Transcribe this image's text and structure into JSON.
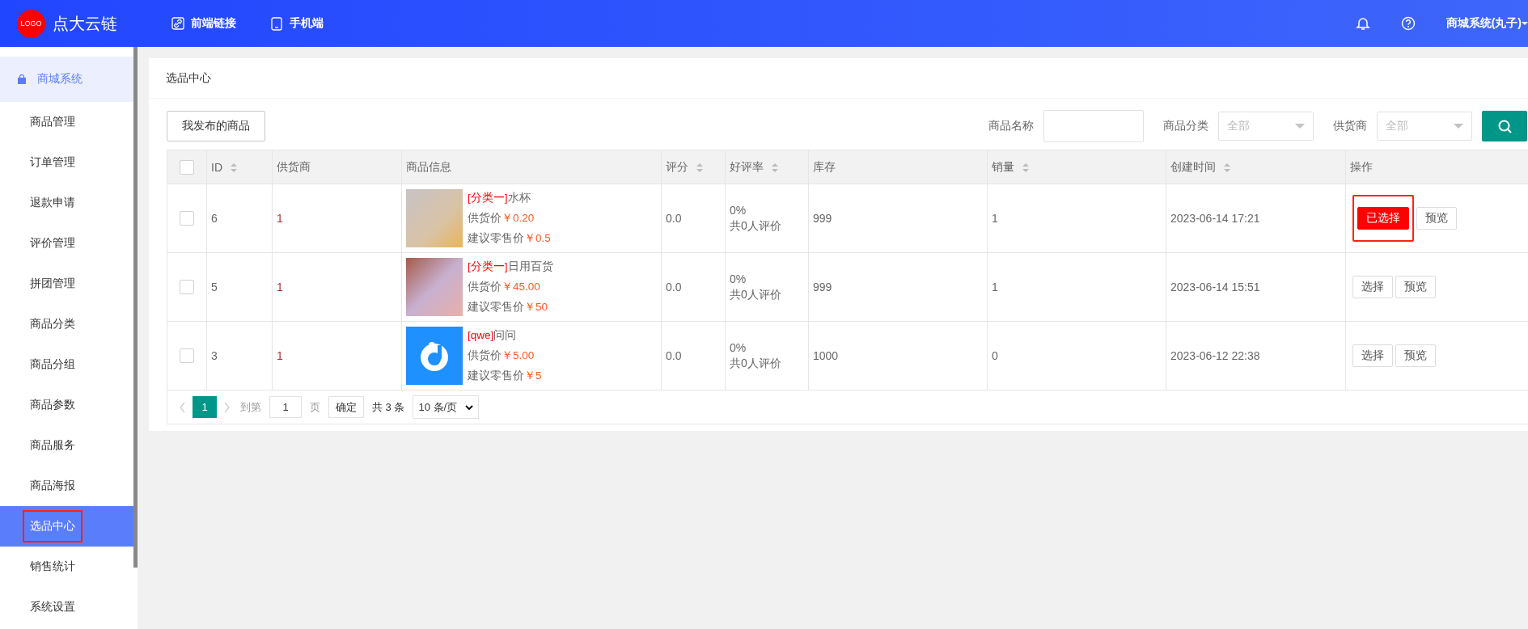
{
  "header": {
    "logo": "LOGO",
    "brand": "点大云链",
    "nav": [
      {
        "label": "前端链接",
        "kind": "link"
      },
      {
        "label": "手机端",
        "kind": "phone"
      }
    ],
    "user": "商城系统(丸子)"
  },
  "sidebar": {
    "group": {
      "label": "商城系统",
      "selected": true
    },
    "items": [
      {
        "label": "商品管理",
        "selected": false,
        "highlighted": false
      },
      {
        "label": "订单管理",
        "selected": false,
        "highlighted": false
      },
      {
        "label": "退款申请",
        "selected": false,
        "highlighted": false
      },
      {
        "label": "评价管理",
        "selected": false,
        "highlighted": false
      },
      {
        "label": "拼团管理",
        "selected": false,
        "highlighted": false
      },
      {
        "label": "商品分类",
        "selected": false,
        "highlighted": false
      },
      {
        "label": "商品分组",
        "selected": false,
        "highlighted": false
      },
      {
        "label": "商品参数",
        "selected": false,
        "highlighted": false
      },
      {
        "label": "商品服务",
        "selected": false,
        "highlighted": false
      },
      {
        "label": "商品海报",
        "selected": false,
        "highlighted": false
      },
      {
        "label": "选品中心",
        "selected": true,
        "highlighted": true
      },
      {
        "label": "销售统计",
        "selected": false,
        "highlighted": false
      },
      {
        "label": "系统设置",
        "selected": false,
        "highlighted": false
      }
    ]
  },
  "panel": {
    "title": "选品中心",
    "my_products_button": "我发布的商品",
    "filters": [
      {
        "label": "商品名称",
        "kind": "input"
      },
      {
        "label": "商品分类",
        "kind": "select",
        "placeholder": "全部"
      },
      {
        "label": "供货商",
        "kind": "select",
        "placeholder": "全部"
      }
    ],
    "table": {
      "select_all": {
        "checked": false
      },
      "columns": [
        {
          "label": "ID",
          "sortable": true
        },
        {
          "label": "供货商",
          "sortable": false
        },
        {
          "label": "商品信息",
          "sortable": false
        },
        {
          "label": "评分",
          "sortable": true
        },
        {
          "label": "好评率",
          "sortable": true
        },
        {
          "label": "库存",
          "sortable": false
        },
        {
          "label": "销量",
          "sortable": true
        },
        {
          "label": "创建时间",
          "sortable": true
        },
        {
          "label": "操作",
          "sortable": false
        }
      ],
      "rows": [
        {
          "checked": false,
          "id": "6",
          "supplier": "1",
          "kind": "photo",
          "category": "[分类一]",
          "name": "水杯",
          "supply_label": "供货价",
          "supply_price": "￥0.20",
          "retail_label": "建议零售价",
          "retail_price": "￥0.5",
          "rating": "0.0",
          "good_rate": "0%",
          "reviews": "共0人评价",
          "stock": "999",
          "sales": "1",
          "created": "2023-06-14 17:21",
          "actions": [
            {
              "label": "已选择",
              "selected": true,
              "highlighted": true
            },
            {
              "label": "预览",
              "selected": false,
              "highlighted": false
            }
          ]
        },
        {
          "checked": false,
          "id": "5",
          "supplier": "1",
          "kind": "photo",
          "category": "[分类一]",
          "name": "日用百货",
          "supply_label": "供货价",
          "supply_price": "￥45.00",
          "retail_label": "建议零售价",
          "retail_price": "￥50",
          "rating": "0.0",
          "good_rate": "0%",
          "reviews": "共0人评价",
          "stock": "999",
          "sales": "1",
          "created": "2023-06-14 15:51",
          "actions": [
            {
              "label": "选择",
              "selected": false,
              "highlighted": false
            },
            {
              "label": "预览",
              "selected": false,
              "highlighted": false
            }
          ]
        },
        {
          "checked": false,
          "id": "3",
          "supplier": "1",
          "kind": "app-logo",
          "category": "[qwe]",
          "name": "问问",
          "supply_label": "供货价",
          "supply_price": "￥5.00",
          "retail_label": "建议零售价",
          "retail_price": "￥5",
          "rating": "0.0",
          "good_rate": "0%",
          "reviews": "共0人评价",
          "stock": "1000",
          "sales": "0",
          "created": "2023-06-12 22:38",
          "actions": [
            {
              "label": "选择",
              "selected": false,
              "highlighted": false
            },
            {
              "label": "预览",
              "selected": false,
              "highlighted": false
            }
          ]
        }
      ]
    },
    "pagination": {
      "pages": [
        {
          "label": "1",
          "selected": true
        }
      ],
      "goto_label": "到第",
      "goto_value": "1",
      "page_unit": "页",
      "confirm": "确定",
      "total": "共 3 条",
      "page_size": "10 条/页"
    }
  }
}
